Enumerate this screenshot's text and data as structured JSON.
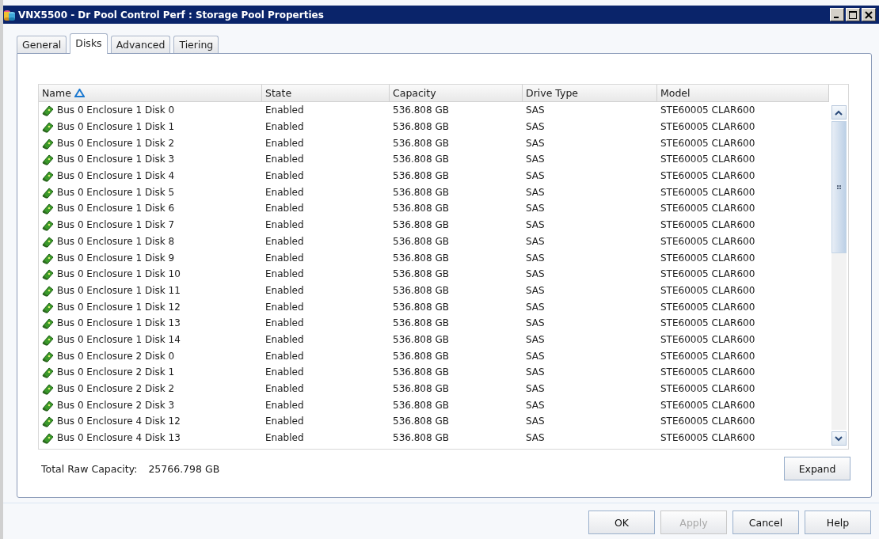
{
  "window": {
    "title": "VNX5500 - Dr Pool Control Perf : Storage Pool Properties"
  },
  "tabs": [
    {
      "label": "General",
      "selected": false
    },
    {
      "label": "Disks",
      "selected": true
    },
    {
      "label": "Advanced",
      "selected": false
    },
    {
      "label": "Tiering",
      "selected": false
    }
  ],
  "table": {
    "columns": [
      {
        "label": "Name",
        "sorted": true
      },
      {
        "label": "State",
        "sorted": false
      },
      {
        "label": "Capacity",
        "sorted": false
      },
      {
        "label": "Drive Type",
        "sorted": false
      },
      {
        "label": "Model",
        "sorted": false
      }
    ],
    "rows": [
      [
        "Bus 0 Enclosure 1 Disk 0",
        "Enabled",
        "536.808 GB",
        "SAS",
        "STE60005 CLAR600"
      ],
      [
        "Bus 0 Enclosure 1 Disk 1",
        "Enabled",
        "536.808 GB",
        "SAS",
        "STE60005 CLAR600"
      ],
      [
        "Bus 0 Enclosure 1 Disk 2",
        "Enabled",
        "536.808 GB",
        "SAS",
        "STE60005 CLAR600"
      ],
      [
        "Bus 0 Enclosure 1 Disk 3",
        "Enabled",
        "536.808 GB",
        "SAS",
        "STE60005 CLAR600"
      ],
      [
        "Bus 0 Enclosure 1 Disk 4",
        "Enabled",
        "536.808 GB",
        "SAS",
        "STE60005 CLAR600"
      ],
      [
        "Bus 0 Enclosure 1 Disk 5",
        "Enabled",
        "536.808 GB",
        "SAS",
        "STE60005 CLAR600"
      ],
      [
        "Bus 0 Enclosure 1 Disk 6",
        "Enabled",
        "536.808 GB",
        "SAS",
        "STE60005 CLAR600"
      ],
      [
        "Bus 0 Enclosure 1 Disk 7",
        "Enabled",
        "536.808 GB",
        "SAS",
        "STE60005 CLAR600"
      ],
      [
        "Bus 0 Enclosure 1 Disk 8",
        "Enabled",
        "536.808 GB",
        "SAS",
        "STE60005 CLAR600"
      ],
      [
        "Bus 0 Enclosure 1 Disk 9",
        "Enabled",
        "536.808 GB",
        "SAS",
        "STE60005 CLAR600"
      ],
      [
        "Bus 0 Enclosure 1 Disk 10",
        "Enabled",
        "536.808 GB",
        "SAS",
        "STE60005 CLAR600"
      ],
      [
        "Bus 0 Enclosure 1 Disk 11",
        "Enabled",
        "536.808 GB",
        "SAS",
        "STE60005 CLAR600"
      ],
      [
        "Bus 0 Enclosure 1 Disk 12",
        "Enabled",
        "536.808 GB",
        "SAS",
        "STE60005 CLAR600"
      ],
      [
        "Bus 0 Enclosure 1 Disk 13",
        "Enabled",
        "536.808 GB",
        "SAS",
        "STE60005 CLAR600"
      ],
      [
        "Bus 0 Enclosure 1 Disk 14",
        "Enabled",
        "536.808 GB",
        "SAS",
        "STE60005 CLAR600"
      ],
      [
        "Bus 0 Enclosure 2 Disk 0",
        "Enabled",
        "536.808 GB",
        "SAS",
        "STE60005 CLAR600"
      ],
      [
        "Bus 0 Enclosure 2 Disk 1",
        "Enabled",
        "536.808 GB",
        "SAS",
        "STE60005 CLAR600"
      ],
      [
        "Bus 0 Enclosure 2 Disk 2",
        "Enabled",
        "536.808 GB",
        "SAS",
        "STE60005 CLAR600"
      ],
      [
        "Bus 0 Enclosure 2 Disk 3",
        "Enabled",
        "536.808 GB",
        "SAS",
        "STE60005 CLAR600"
      ],
      [
        "Bus 0 Enclosure 4 Disk 12",
        "Enabled",
        "536.808 GB",
        "SAS",
        "STE60005 CLAR600"
      ],
      [
        "Bus 0 Enclosure 4 Disk 13",
        "Enabled",
        "536.808 GB",
        "SAS",
        "STE60005 CLAR600"
      ]
    ]
  },
  "total": {
    "label": "Total Raw Capacity:",
    "value": "25766.798 GB"
  },
  "expand_button": {
    "label": "Expand",
    "disabled": false
  },
  "buttons": [
    {
      "label": "OK",
      "disabled": false
    },
    {
      "label": "Apply",
      "disabled": true
    },
    {
      "label": "Cancel",
      "disabled": false
    },
    {
      "label": "Help",
      "disabled": false
    }
  ]
}
